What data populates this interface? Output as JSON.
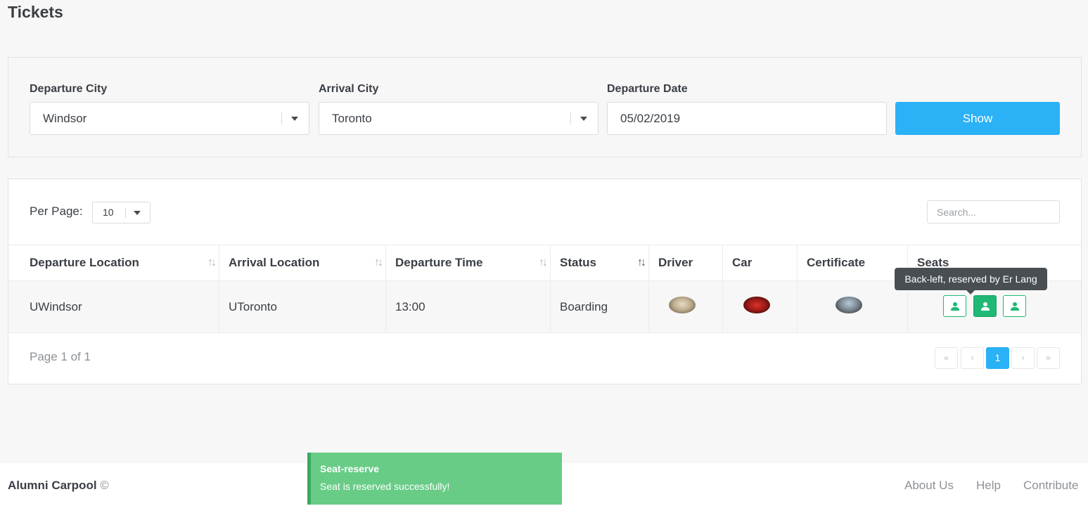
{
  "page": {
    "title": "Tickets"
  },
  "filters": {
    "departure_city": {
      "label": "Departure City",
      "value": "Windsor"
    },
    "arrival_city": {
      "label": "Arrival City",
      "value": "Toronto"
    },
    "departure_date": {
      "label": "Departure Date",
      "value": "05/02/2019"
    },
    "show_button": "Show"
  },
  "table": {
    "per_page_label": "Per Page:",
    "per_page_value": "10",
    "search_placeholder": "Search...",
    "columns": [
      "Departure Location",
      "Arrival Location",
      "Departure Time",
      "Status",
      "Driver",
      "Car",
      "Certificate",
      "Seats"
    ],
    "rows": [
      {
        "departure_location": "UWindsor",
        "arrival_location": "UToronto",
        "departure_time": "13:00",
        "status": "Boarding",
        "driver": "driver-photo",
        "car": "car-photo",
        "certificate": "certificate-photo",
        "seats": [
          "seat-icon",
          "seat-icon",
          "seat-icon"
        ]
      }
    ],
    "tooltip": "Back-left, reserved by Er Lang",
    "page_info": "Page 1 of 1",
    "pagination": {
      "first": "«",
      "prev": "‹",
      "current": "1",
      "next": "›",
      "last": "»"
    }
  },
  "footer": {
    "brand": "Alumni Carpool",
    "copyright": "©",
    "links": [
      "About Us",
      "Help",
      "Contribute"
    ]
  },
  "toast": {
    "title": "Seat-reserve",
    "message": "Seat is reserved successfully!"
  },
  "colors": {
    "accent": "#2bb1f5",
    "seat_green": "#1fb874",
    "toast_green": "#68cc87"
  }
}
